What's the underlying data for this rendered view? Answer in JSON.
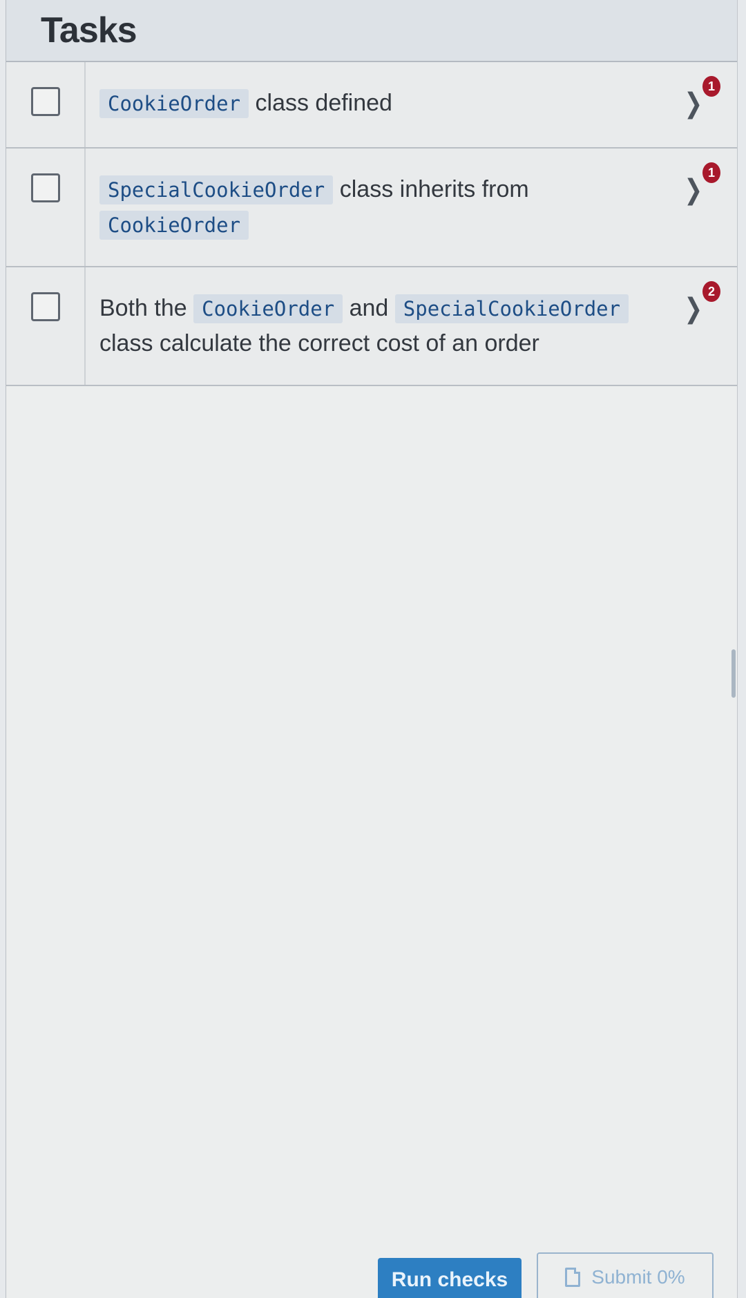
{
  "header": {
    "title": "Tasks"
  },
  "tasks": [
    {
      "code_1": "CookieOrder",
      "text_1": " class defined",
      "badge": "1"
    },
    {
      "code_1": "SpecialCookieOrder",
      "text_1": " class inherits from",
      "code_2": "CookieOrder",
      "badge": "1"
    },
    {
      "text_0": "Both the ",
      "code_1": "CookieOrder",
      "text_1": " and ",
      "code_2": "SpecialCookieOrder",
      "text_2": "class calculate the correct cost of an order",
      "badge": "2"
    }
  ],
  "footer": {
    "run_label": "Run checks",
    "submit_label": "Submit 0%"
  },
  "colors": {
    "badge": "#a8192c",
    "run_button": "#2d7fc2",
    "code_text": "#1d4d85"
  },
  "icons": {
    "chevron": "chevron-right-icon",
    "submit": "document-icon"
  }
}
